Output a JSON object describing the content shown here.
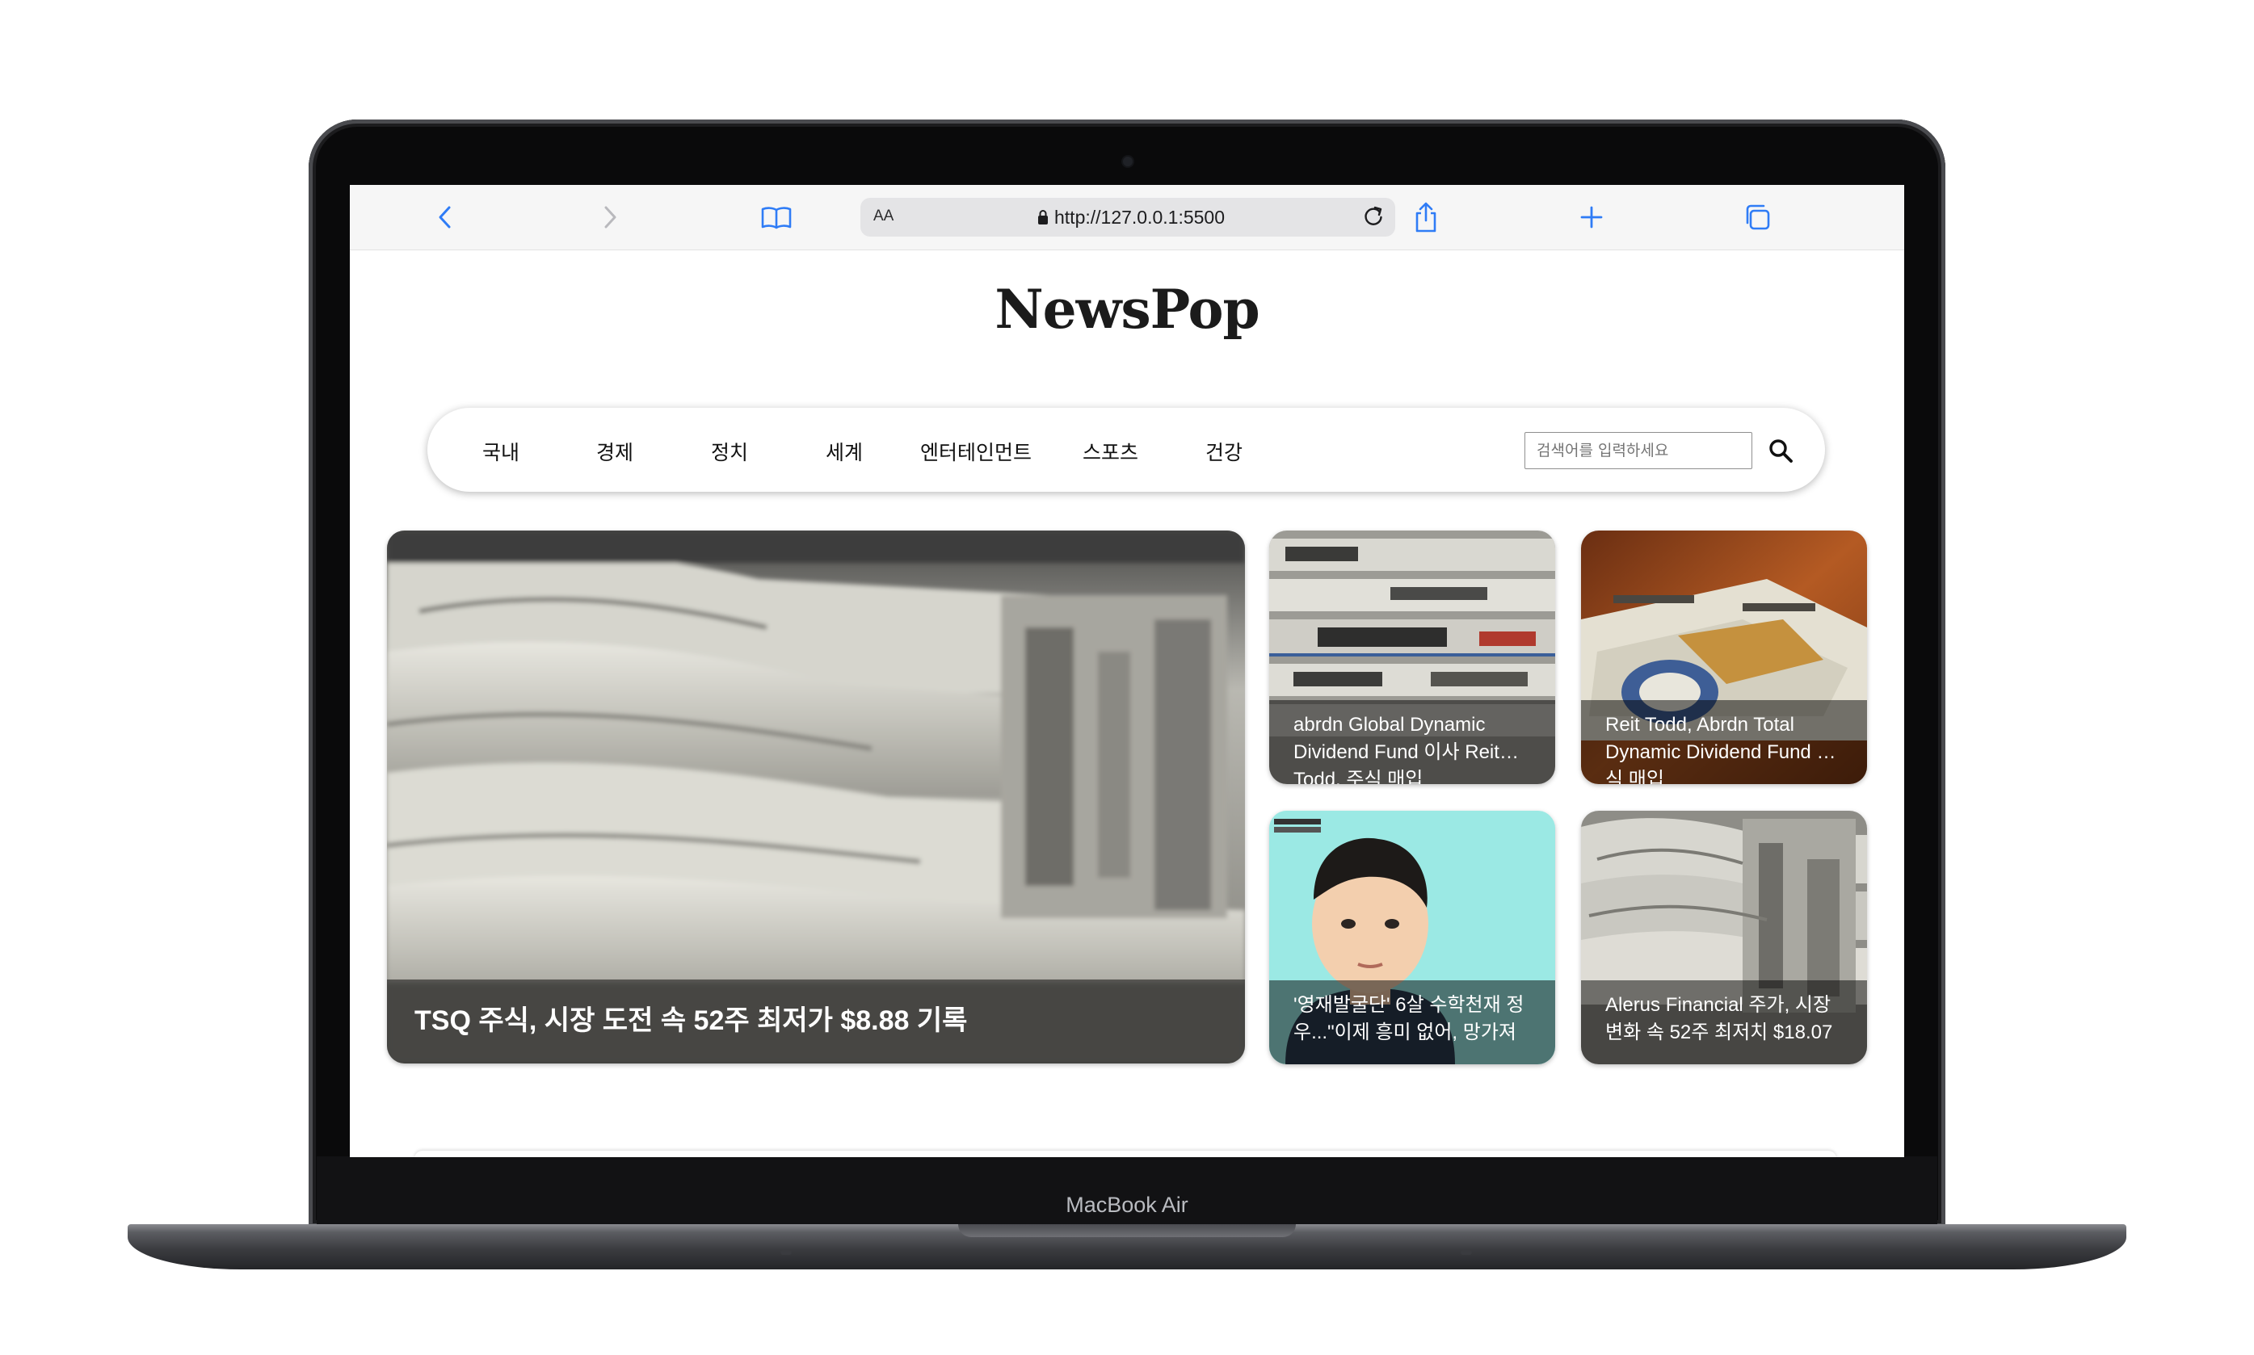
{
  "device": {
    "label": "MacBook Air"
  },
  "browser": {
    "text_size_label": "AA",
    "url": "http://127.0.0.1:5500",
    "icons": [
      "back-icon",
      "forward-icon",
      "bookmarks-icon",
      "lock-icon",
      "reload-icon",
      "share-icon",
      "new-tab-icon",
      "tabs-icon"
    ],
    "accent_color": "#2f7cf6"
  },
  "site": {
    "title": "NewsPop",
    "nav": [
      "국내",
      "경제",
      "정치",
      "세계",
      "엔터테인먼트",
      "스포츠",
      "건강"
    ],
    "search": {
      "placeholder": "검색어를 입력하세요",
      "icon": "search-icon"
    }
  },
  "articles": {
    "featured": {
      "title": "TSQ 주식, 시장 도전 속 52주 최저가 $8.88 기록",
      "image": "newspaper-stack"
    },
    "side": [
      {
        "title": "abrdn Global Dynamic Dividend Fund 이사 Reit Todd, 주식 매입",
        "image": "newspaper-stack"
      },
      {
        "title": "Reit Todd, Abrdn Total Dynamic Dividend Fund 주식 매입",
        "image": "newspaper-stack"
      },
      {
        "title": "'영재발굴단' 6살 수학천재 정우...\"이제 흥미 없어, 망가져",
        "image": "boy-portrait"
      },
      {
        "title": "Alerus Financial 주가, 시장 변화 속 52주 최저치 $18.07",
        "image": "newspaper-stack"
      }
    ]
  }
}
